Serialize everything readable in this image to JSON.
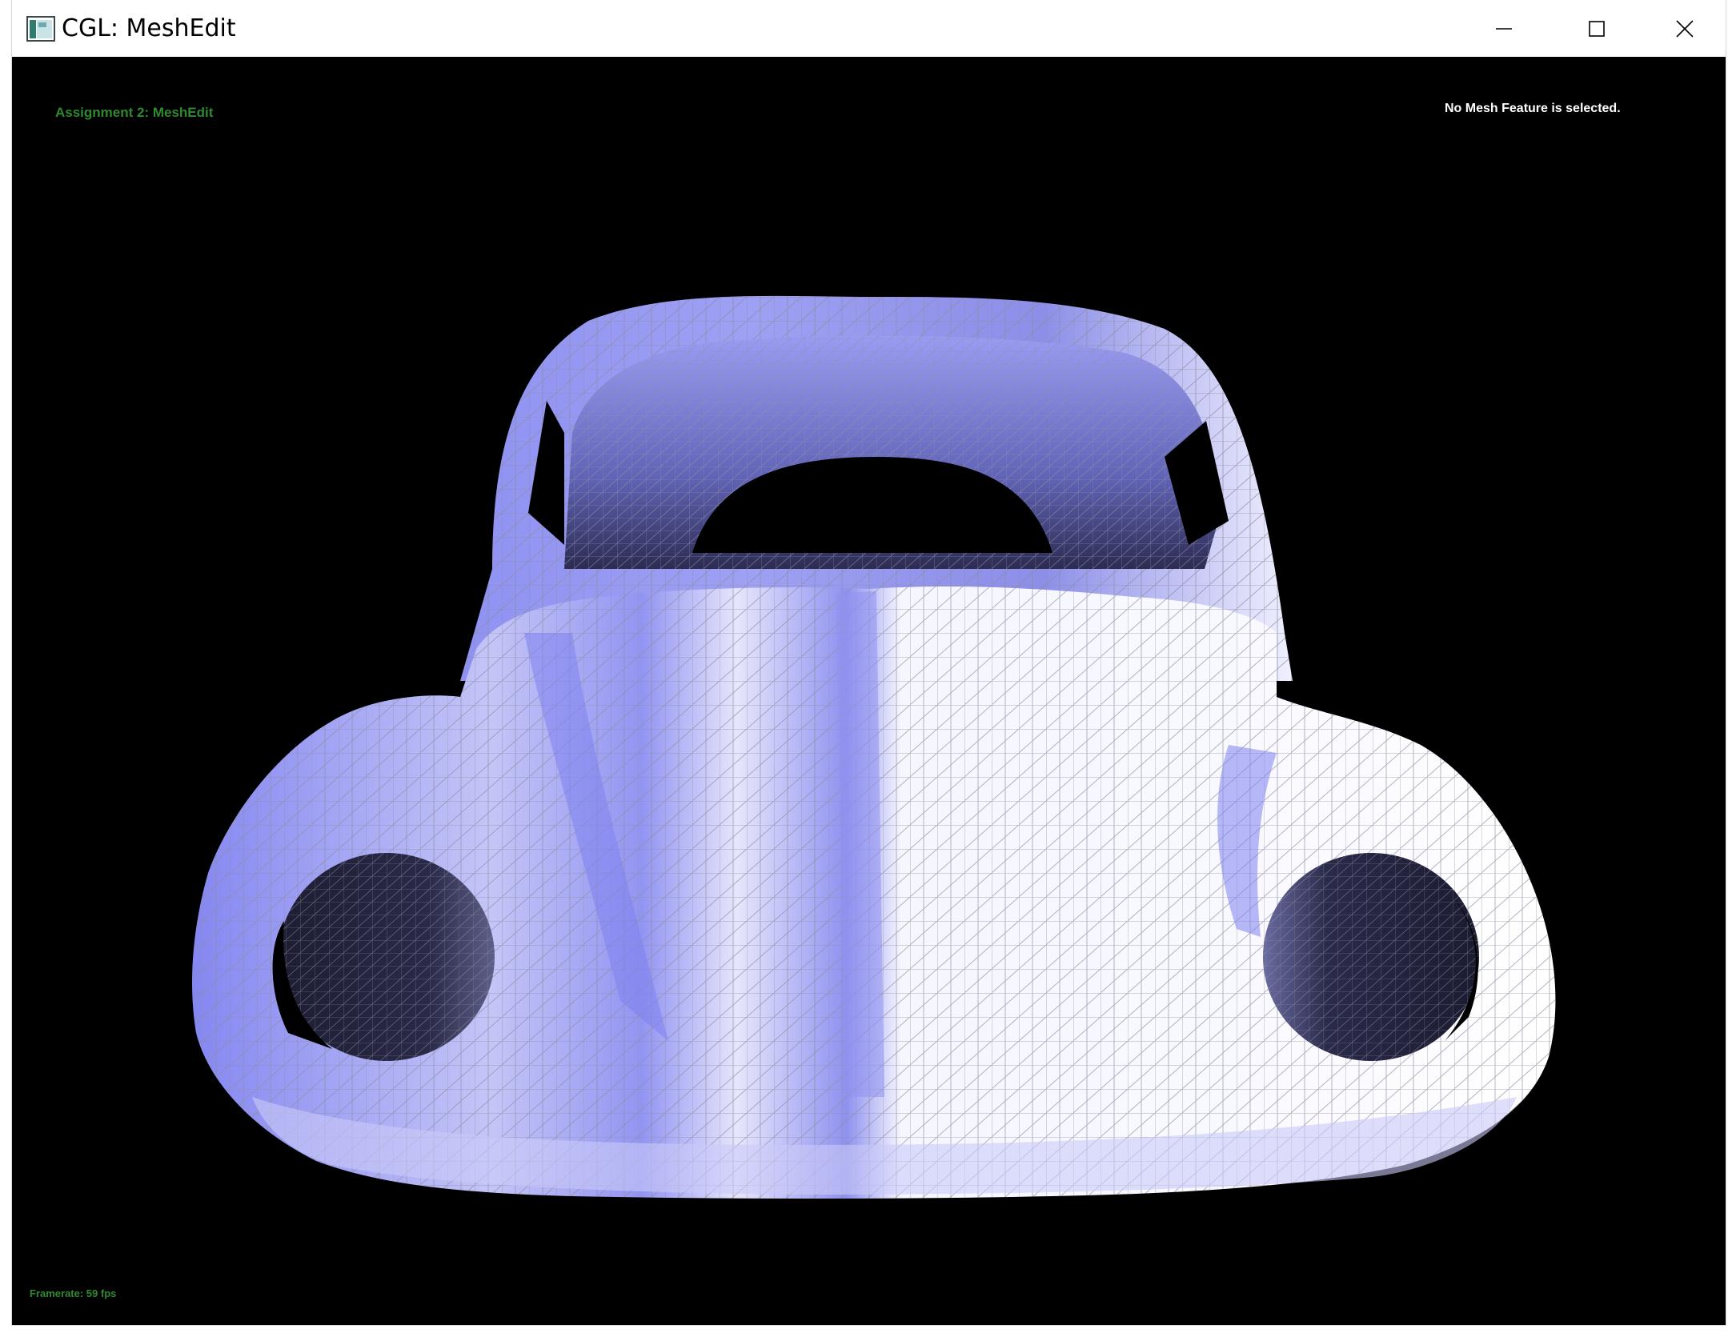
{
  "window": {
    "title": "CGL: MeshEdit",
    "minimize_label": "Minimize",
    "maximize_label": "Maximize",
    "close_label": "Close"
  },
  "viewport": {
    "assignment_label": "Assignment 2: MeshEdit",
    "selection_status": "No Mesh Feature is selected.",
    "framerate_text": "Framerate: 59 fps"
  },
  "colors": {
    "background": "#000000",
    "mesh_fill_light": "#f4f4ff",
    "mesh_fill_mid": "#b9b9f5",
    "mesh_fill_dark": "#7e80f0",
    "mesh_interior": "#23233f",
    "overlay_green": "#2f8a2f",
    "overlay_white": "#ffffff"
  },
  "icons": {
    "app": "app-window-icon",
    "minimize": "minimize-icon",
    "maximize": "maximize-icon",
    "close": "close-icon"
  }
}
